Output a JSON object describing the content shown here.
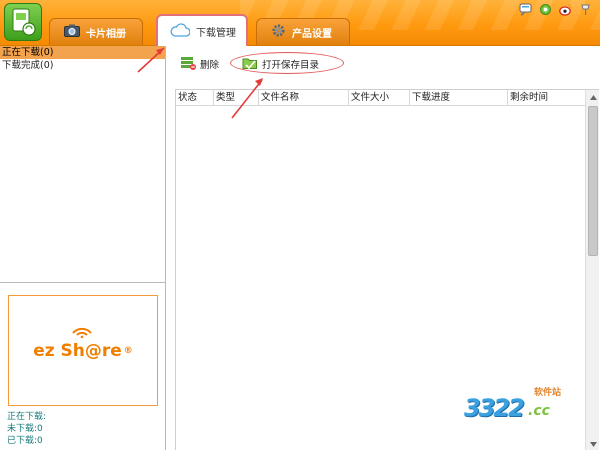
{
  "header": {
    "tabs": [
      {
        "label": "卡片相册",
        "icon": "camera-icon"
      },
      {
        "label": "下载管理",
        "icon": "cloud-icon"
      },
      {
        "label": "产品设置",
        "icon": "gear-icon"
      }
    ],
    "top_icons": [
      "chat-icon",
      "settings-icon",
      "weibo-icon",
      "pin-icon"
    ]
  },
  "sidebar": {
    "items": [
      {
        "label": "正在下载(0)",
        "active": true
      },
      {
        "label": "下载完成(0)",
        "active": false
      }
    ]
  },
  "ad": {
    "brand": "ez Sh@re",
    "registered": "®"
  },
  "stats": {
    "downloading": "正在下载:",
    "pending": "未下载:0",
    "done": "已下载:0"
  },
  "toolbar": {
    "delete_label": "删除",
    "open_folder_label": "打开保存目录"
  },
  "table": {
    "columns": [
      "状态",
      "类型",
      "文件名称",
      "文件大小",
      "下载进度",
      "剩余时间"
    ]
  },
  "watermark": {
    "number": "3322",
    "tld": ".cc",
    "tag": "软件站"
  },
  "colors": {
    "header_orange": "#ff9a10",
    "active_item": "#f3a24d",
    "accent_red": "#e25a5a",
    "stats_text": "#167a7a"
  }
}
